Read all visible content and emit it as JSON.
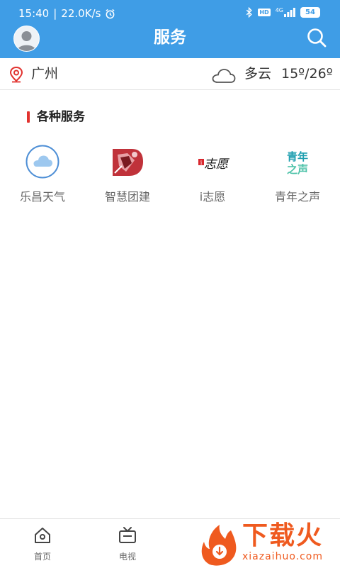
{
  "status_bar": {
    "time": "15:40",
    "speed": "22.0K/s",
    "network": "4G",
    "hd": "HD",
    "battery": "54"
  },
  "header": {
    "title": "服务"
  },
  "location": {
    "city": "广州",
    "weather": "多云",
    "temperature": "15º/26º"
  },
  "section": {
    "title": "各种服务"
  },
  "services": [
    {
      "label": "乐昌天气",
      "icon": "cloud-icon"
    },
    {
      "label": "智慧团建",
      "icon": "tuanjian-logo-icon"
    },
    {
      "label": "i志愿",
      "icon": "volunteer-logo-icon",
      "logo_text": "志愿"
    },
    {
      "label": "青年之声",
      "icon": "youth-voice-logo-icon",
      "logo_text_top": "青年",
      "logo_text_bottom": "之声"
    }
  ],
  "tabs": [
    {
      "label": "首页",
      "icon": "home-icon"
    },
    {
      "label": "电视",
      "icon": "tv-icon"
    }
  ],
  "watermark": {
    "text": "下载火",
    "sub": "xiazaihuo.com"
  },
  "colors": {
    "header": "#3f9de6",
    "accent": "#e2332f",
    "watermark": "#ef5a1f"
  }
}
